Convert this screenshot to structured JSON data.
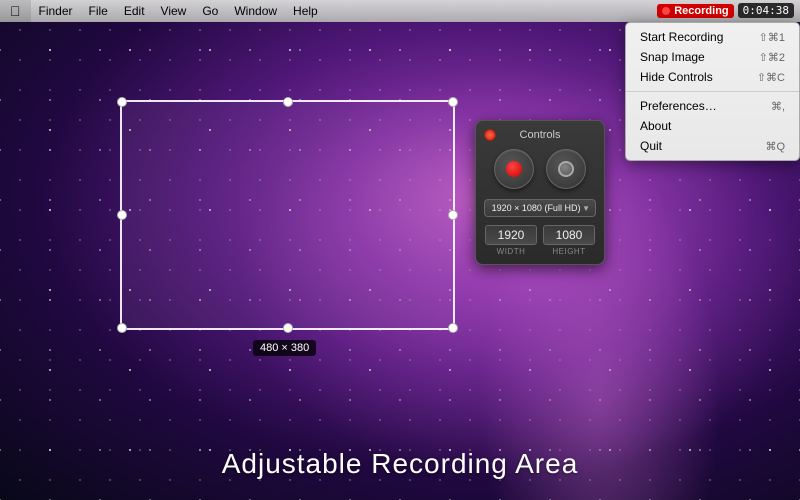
{
  "menubar": {
    "apple": "⌘",
    "items": [
      {
        "label": "Finder"
      },
      {
        "label": "File"
      },
      {
        "label": "Edit"
      },
      {
        "label": "View"
      },
      {
        "label": "Go"
      },
      {
        "label": "Window"
      },
      {
        "label": "Help"
      }
    ],
    "recording_label": "Recording",
    "timer": "0:04:38"
  },
  "dropdown": {
    "items": [
      {
        "label": "Start Recording",
        "shortcut": "⇧⌘1"
      },
      {
        "label": "Snap Image",
        "shortcut": "⇧⌘2"
      },
      {
        "label": "Hide Controls",
        "shortcut": "⇧⌘C"
      },
      {
        "separator": true
      },
      {
        "label": "Preferences…",
        "shortcut": "⌘,"
      },
      {
        "label": "About"
      },
      {
        "label": "Quit",
        "shortcut": "⌘Q"
      }
    ]
  },
  "selection": {
    "size_label": "480 × 380"
  },
  "controls": {
    "title": "Controls",
    "resolution": "1920 × 1080 (Full HD)",
    "width_value": "1920",
    "height_value": "1080",
    "width_label": "WIDTH",
    "height_label": "HEIGHT"
  },
  "bottom": {
    "text": "Adjustable Recording Area"
  }
}
